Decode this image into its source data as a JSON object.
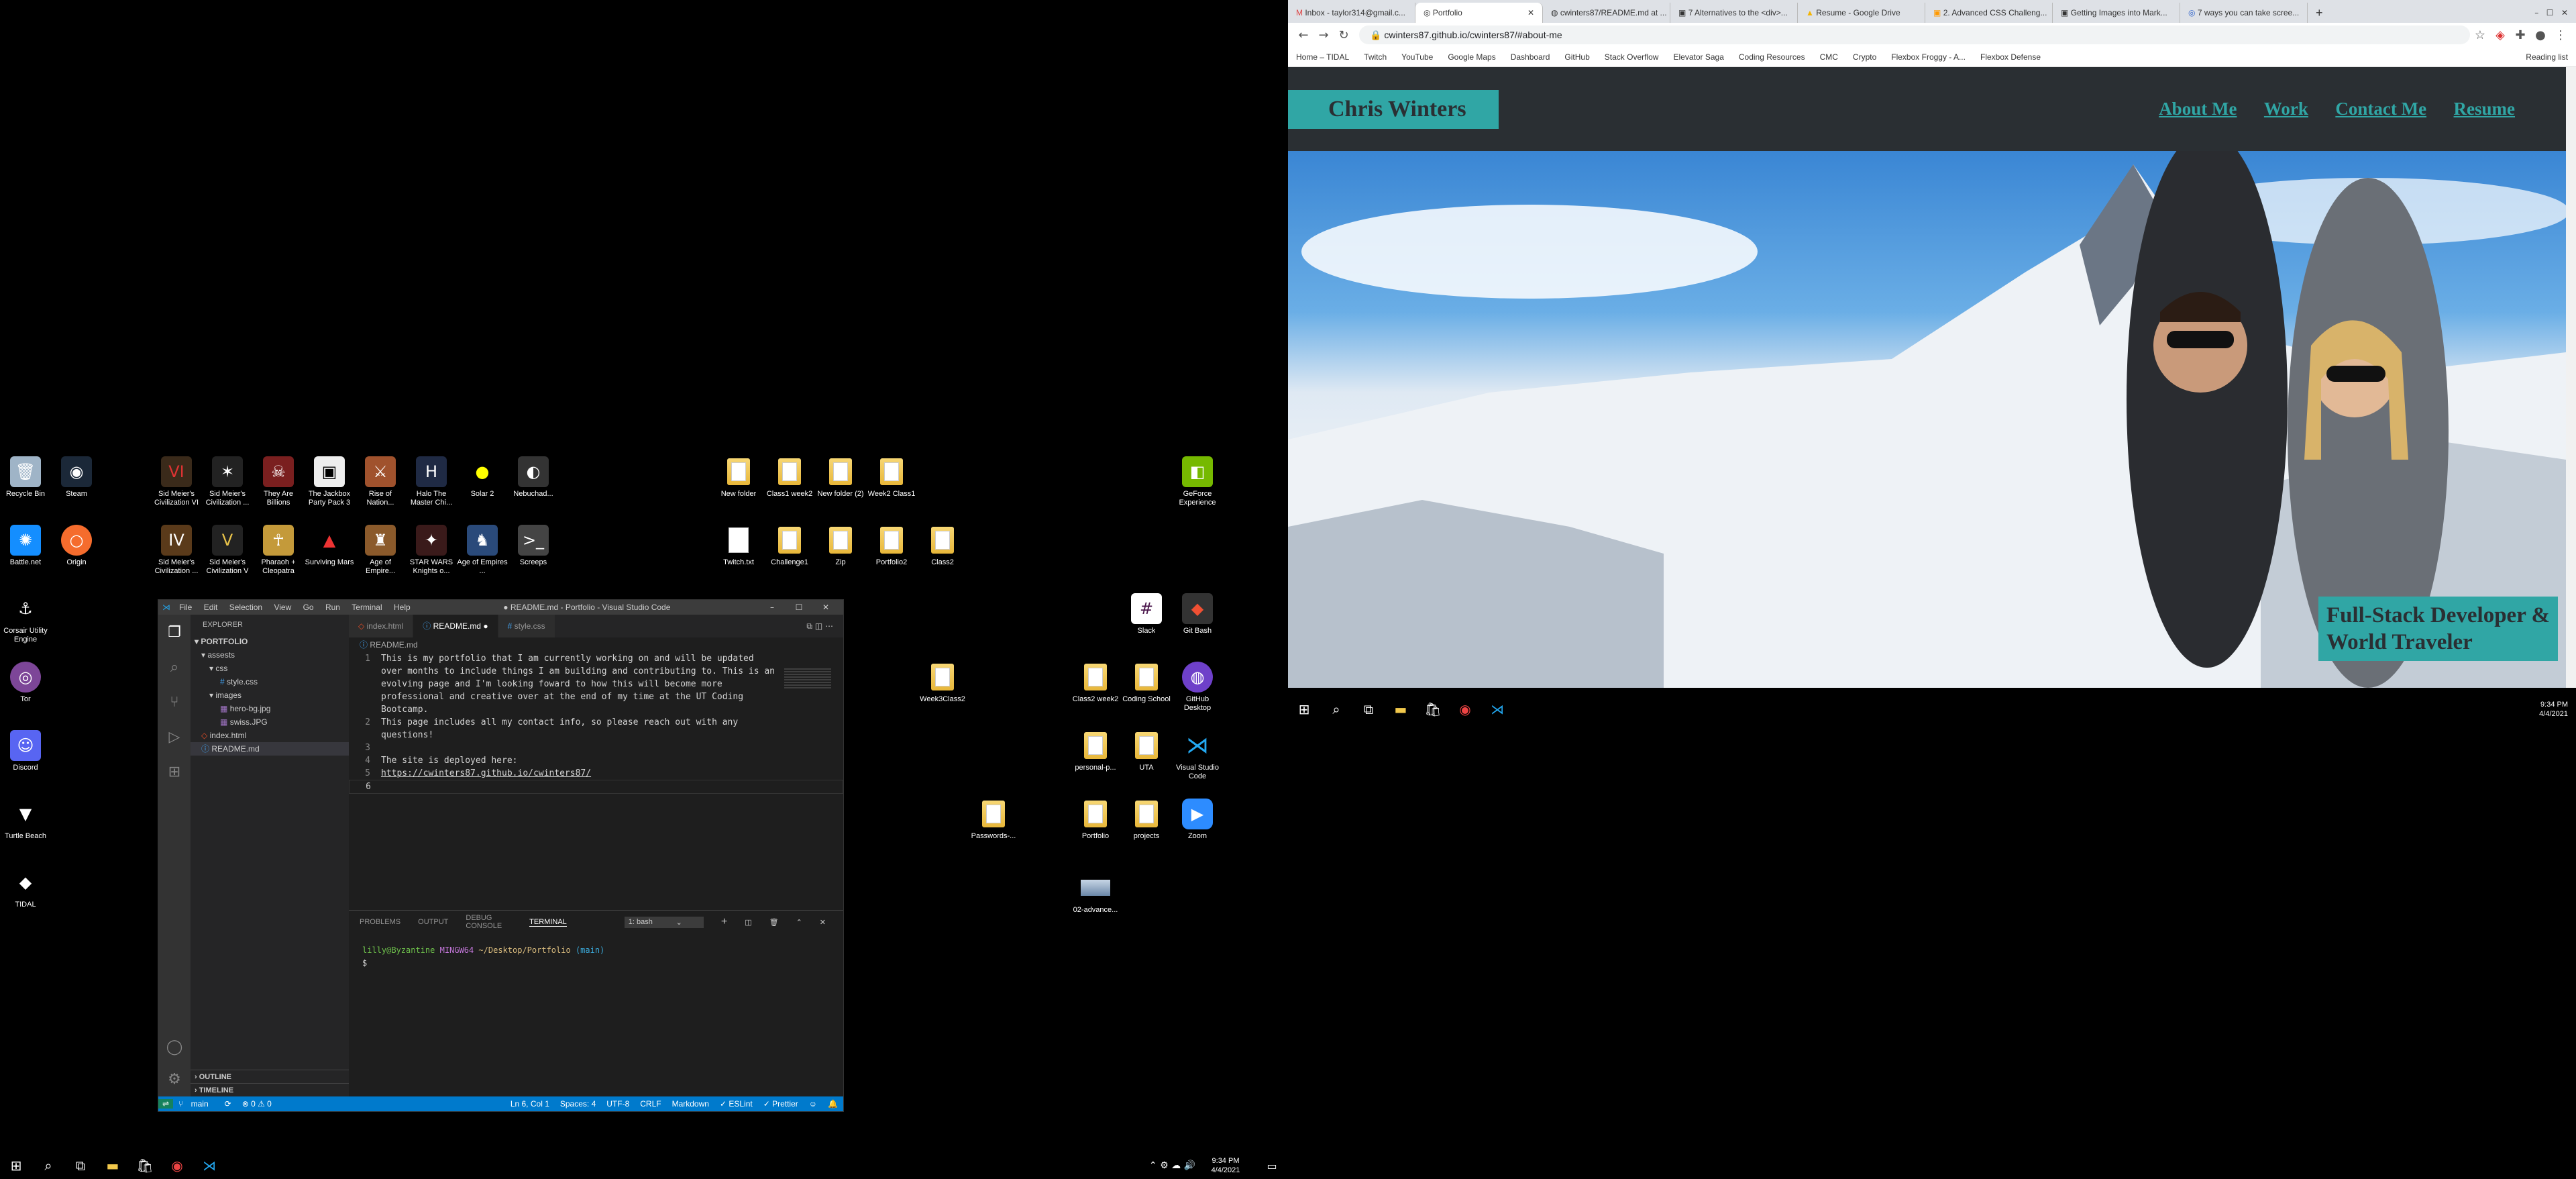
{
  "desktop": {
    "icons": [
      {
        "label": "Recycle Bin"
      },
      {
        "label": "Steam"
      },
      {
        "label": "Sid Meier's Civilization VI"
      },
      {
        "label": "Sid Meier's Civilization ..."
      },
      {
        "label": "They Are Billions"
      },
      {
        "label": "The Jackbox Party Pack 3"
      },
      {
        "label": "Rise of Nation..."
      },
      {
        "label": "Halo The Master Chi..."
      },
      {
        "label": "Solar 2"
      },
      {
        "label": "Nebuchad..."
      },
      {
        "label": "Battle.net"
      },
      {
        "label": "Origin"
      },
      {
        "label": "Sid Meier's Civilization ..."
      },
      {
        "label": "Sid Meier's Civilization V"
      },
      {
        "label": "Pharaoh + Cleopatra"
      },
      {
        "label": "Surviving Mars"
      },
      {
        "label": "Age of Empire..."
      },
      {
        "label": "STAR WARS Knights o..."
      },
      {
        "label": "Age of Empires ..."
      },
      {
        "label": "Screeps"
      },
      {
        "label": "Corsair Utility Engine"
      },
      {
        "label": "Tor"
      },
      {
        "label": "Discord"
      },
      {
        "label": "Turtle Beach"
      },
      {
        "label": "TIDAL"
      },
      {
        "label": "New folder"
      },
      {
        "label": "Class1 week2"
      },
      {
        "label": "New folder (2)"
      },
      {
        "label": "Week2 Class1"
      },
      {
        "label": "Twitch.txt"
      },
      {
        "label": "Challenge1"
      },
      {
        "label": "Zip"
      },
      {
        "label": "Portfolio2"
      },
      {
        "label": "Class2"
      },
      {
        "label": "GeForce Experience"
      },
      {
        "label": "Slack"
      },
      {
        "label": "Git Bash"
      },
      {
        "label": "Week3Class2"
      },
      {
        "label": "Class2 week2"
      },
      {
        "label": "Coding School"
      },
      {
        "label": "GitHub Desktop"
      },
      {
        "label": "personal-p..."
      },
      {
        "label": "UTA"
      },
      {
        "label": "Visual Studio Code"
      },
      {
        "label": "Passwords-..."
      },
      {
        "label": "Portfolio"
      },
      {
        "label": "projects"
      },
      {
        "label": "Zoom"
      },
      {
        "label": "02-advance..."
      }
    ]
  },
  "taskbar_left": {
    "time": "9:34 PM",
    "date": "4/4/2021"
  },
  "taskbar_right": {
    "time": "9:34 PM",
    "date": "4/4/2021"
  },
  "vscode": {
    "menu": [
      "File",
      "Edit",
      "Selection",
      "View",
      "Go",
      "Run",
      "Terminal",
      "Help"
    ],
    "title": "● README.md - Portfolio - Visual Studio Code",
    "explorer_header": "EXPLORER",
    "tree": [
      "PORTFOLIO",
      "assests",
      "css",
      "style.css",
      "images",
      "hero-bg.jpg",
      "swiss.JPG",
      "index.html",
      "README.md"
    ],
    "tabs": [
      "index.html",
      "README.md",
      "style.css"
    ],
    "breadcrumb": "README.md",
    "lines": [
      {
        "n": "1",
        "t": "This is my portfolio that I am currently working on and will be updated over months to include things I am building and contributing to. This is an evolving page and I'm looking foward to how this will become more professional and creative over at the end of my time at the UT Coding Bootcamp."
      },
      {
        "n": "2",
        "t": "This page includes all my contact info, so please reach out with any questions!"
      },
      {
        "n": "3",
        "t": ""
      },
      {
        "n": "4",
        "t": "The site is deployed here:"
      },
      {
        "n": "5",
        "t": "https://cwinters87.github.io/cwinters87/"
      },
      {
        "n": "6",
        "t": ""
      }
    ],
    "panel_tabs": [
      "PROBLEMS",
      "OUTPUT",
      "DEBUG CONSOLE",
      "TERMINAL"
    ],
    "terminal_select": "1: bash",
    "terminal_prompt_user": "lilly@Byzantine",
    "terminal_prompt_env": "MINGW64",
    "terminal_prompt_path": "~/Desktop/Portfolio",
    "terminal_prompt_branch": "(main)",
    "terminal_cursor": "$",
    "outline": "OUTLINE",
    "timeline": "TIMELINE",
    "status": {
      "branch": "main",
      "errors": "⊗ 0 ⚠ 0",
      "position": "Ln 6, Col 1",
      "spaces": "Spaces: 4",
      "encoding": "UTF-8",
      "eol": "CRLF",
      "language": "Markdown",
      "eslint": "✓ ESLint",
      "prettier": "✓ Prettier"
    }
  },
  "chrome": {
    "tabs": [
      "Inbox - taylor314@gmail.c...",
      "Portfolio",
      "cwinters87/README.md at ...",
      "7 Alternatives to the <div>...",
      "Resume - Google Drive",
      "2. Advanced CSS Challeng...",
      "Getting Images into Mark...",
      "7 ways you can take scree..."
    ],
    "url": "cwinters87.github.io/cwinters87/#about-me",
    "bookmarks": [
      "Home – TIDAL",
      "Twitch",
      "YouTube",
      "Google Maps",
      "Dashboard",
      "GitHub",
      "Stack Overflow",
      "Elevator Saga",
      "Coding Resources",
      "CMC",
      "Crypto",
      "Flexbox Froggy - A...",
      "Flexbox Defense"
    ],
    "reading_list": "Reading list"
  },
  "site": {
    "name": "Chris Winters",
    "nav": [
      "About Me",
      "Work",
      "Contact Me",
      "Resume"
    ],
    "tagline_1": "Full-Stack Developer &",
    "tagline_2": "World Traveler"
  }
}
